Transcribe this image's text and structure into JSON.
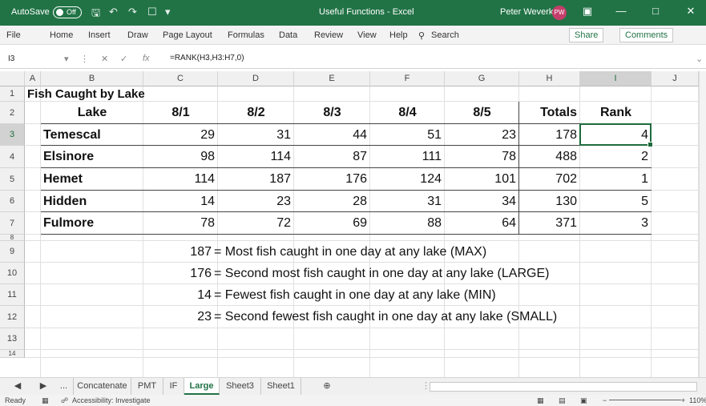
{
  "titlebar": {
    "autosave_label": "AutoSave",
    "autosave_state": "Off",
    "title": "Useful Functions - Excel",
    "user_name": "Peter Weverka",
    "user_initials": "PW"
  },
  "menu": {
    "items": [
      "File",
      "Home",
      "Insert",
      "Draw",
      "Page Layout",
      "Formulas",
      "Data",
      "Review",
      "View",
      "Help"
    ],
    "search_label": "Search",
    "share_label": "Share",
    "comments_label": "Comments"
  },
  "formula_bar": {
    "name_box": "I3",
    "formula": "=RANK(H3,H3:H7,0)"
  },
  "columns": [
    "A",
    "B",
    "C",
    "D",
    "E",
    "F",
    "G",
    "H",
    "I",
    "J"
  ],
  "rows": [
    "1",
    "2",
    "3",
    "4",
    "5",
    "6",
    "7",
    "8",
    "9",
    "10",
    "11",
    "12",
    "13",
    "14"
  ],
  "sheet": {
    "title": "Fish Caught by Lake",
    "headers": [
      "Lake",
      "8/1",
      "8/2",
      "8/3",
      "8/4",
      "8/5",
      "Totals",
      "Rank"
    ],
    "data": [
      [
        "Temescal",
        "29",
        "31",
        "44",
        "51",
        "23",
        "178",
        "4"
      ],
      [
        "Elsinore",
        "98",
        "114",
        "87",
        "111",
        "78",
        "488",
        "2"
      ],
      [
        "Hemet",
        "114",
        "187",
        "176",
        "124",
        "101",
        "702",
        "1"
      ],
      [
        "Hidden",
        "14",
        "23",
        "28",
        "31",
        "34",
        "130",
        "5"
      ],
      [
        "Fulmore",
        "78",
        "72",
        "69",
        "88",
        "64",
        "371",
        "3"
      ]
    ],
    "stats": [
      {
        "value": "187",
        "text": "= Most fish caught in one day at any lake (MAX)"
      },
      {
        "value": "176",
        "text": "= Second most fish caught in one day at any lake (LARGE)"
      },
      {
        "value": "14",
        "text": "= Fewest fish caught in one day at any lake (MIN)"
      },
      {
        "value": "23",
        "text": "= Second fewest fish caught in one day at any lake (SMALL)"
      }
    ]
  },
  "tabs": {
    "ellipsis": "...",
    "items": [
      "Concatenate",
      "PMT",
      "IF",
      "Large",
      "Sheet3",
      "Sheet1"
    ],
    "active": "Large"
  },
  "status": {
    "ready": "Ready",
    "accessibility": "Accessibility: Investigate",
    "zoom": "110%"
  }
}
